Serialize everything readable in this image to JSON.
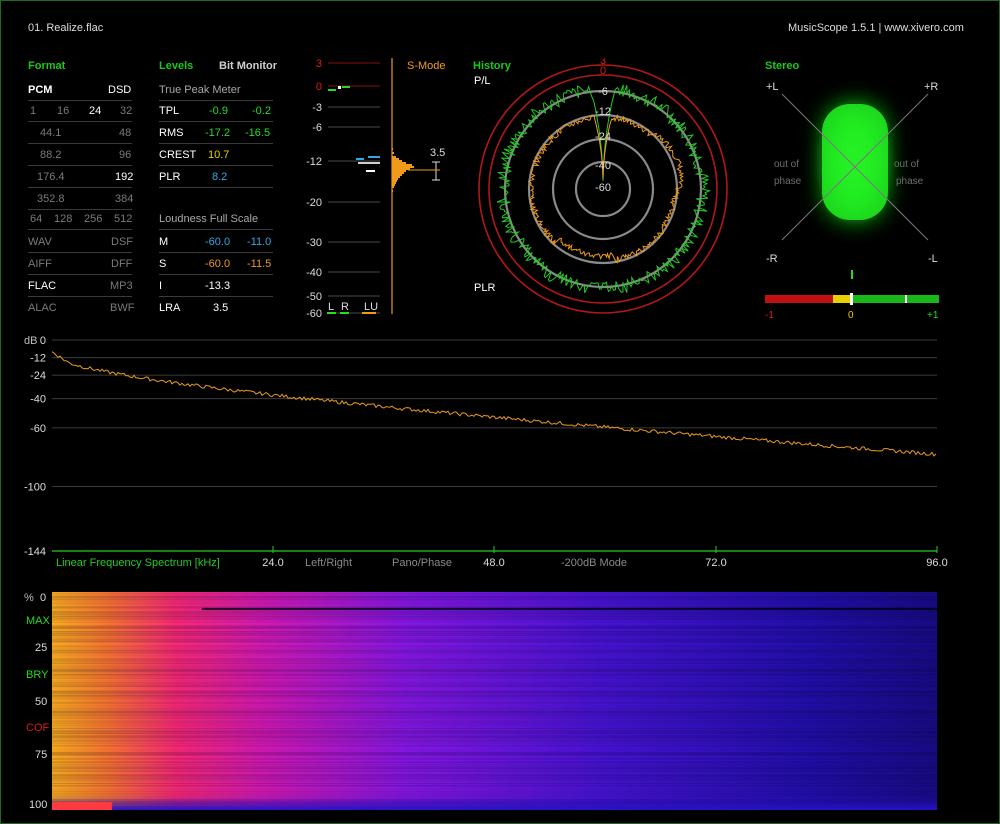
{
  "header": {
    "file": "01. Realize.flac",
    "app": "MusicScope 1.5.1 | www.xivero.com"
  },
  "format": {
    "title": "Format",
    "pcm_label": "PCM",
    "dsd_label": "DSD",
    "bits": [
      "1",
      "16",
      "24",
      "32"
    ],
    "rates_pcm": [
      "44.1",
      "88.2",
      "176.4",
      "352.8"
    ],
    "rates_dsd": [
      "48",
      "96",
      "192",
      "384"
    ],
    "dsd_rates": [
      "64",
      "128",
      "256",
      "512"
    ],
    "containers_left": [
      "WAV",
      "AIFF",
      "FLAC",
      "ALAC"
    ],
    "containers_right": [
      "DSF",
      "DFF",
      "MP3",
      "BWF"
    ]
  },
  "levels": {
    "title": "Levels",
    "bit_monitor": "Bit Monitor",
    "true_peak": "True Peak Meter",
    "rows": [
      {
        "name": "TPL",
        "l": "-0.9",
        "r": "-0.2"
      },
      {
        "name": "RMS",
        "l": "-17.2",
        "r": "-16.5"
      },
      {
        "name": "CREST",
        "l": "10.7"
      },
      {
        "name": "PLR",
        "l": "8.2"
      }
    ],
    "loudness": "Loudness Full Scale",
    "lrows": [
      {
        "name": "M",
        "l": "-60.0",
        "r": "-11.0"
      },
      {
        "name": "S",
        "l": "-60.0",
        "r": "-11.5"
      },
      {
        "name": "I",
        "l": "-13.3"
      },
      {
        "name": "LRA",
        "l": "3.5"
      }
    ]
  },
  "meter": {
    "smode": "S-Mode",
    "ticks": [
      "3",
      "0",
      "-3",
      "-6",
      "-12",
      "-20",
      "-30",
      "-40",
      "-50",
      "-60"
    ],
    "tick_values": [
      3,
      0,
      -3,
      -6,
      -12,
      -20,
      -30,
      -40,
      -50,
      -60
    ],
    "lra": "3.5",
    "l": "L",
    "r": "R",
    "lu": "LU"
  },
  "history": {
    "title": "History",
    "pl": "P/L",
    "plr": "PLR",
    "rings": [
      "3",
      "0",
      "-6",
      "-12",
      "-24",
      "-40",
      "-60"
    ]
  },
  "stereo": {
    "title": "Stereo",
    "pl": "+L",
    "pr": "+R",
    "ml": "-L",
    "mr": "-R",
    "oop_left": [
      "out of",
      "phase"
    ],
    "oop_right": [
      "out of",
      "phase"
    ],
    "corr_labels": [
      "-1",
      "0",
      "+1"
    ]
  },
  "spectrum": {
    "db": "dB",
    "yticks": [
      "0",
      "-12",
      "-24",
      "-40",
      "-60",
      "-100",
      "-144"
    ],
    "ytick_values": [
      0,
      -12,
      -24,
      -40,
      -60,
      -100,
      -144
    ],
    "title": "Linear Frequency Spectrum [kHz]",
    "xticks": [
      "24.0",
      "48.0",
      "72.0",
      "96.0"
    ],
    "modes": [
      "Left/Right",
      "Pano/Phase",
      "-200dB Mode"
    ]
  },
  "spectrogram": {
    "pct": "%",
    "ticks": [
      "0",
      "25",
      "50",
      "75",
      "100"
    ],
    "max": "MAX",
    "bry": "BRY",
    "cof": "COF"
  },
  "colors": {
    "green": "#22dd22",
    "orange": "#f09a1a",
    "red": "#e01818",
    "yellow": "#e8d000",
    "cyan": "#2fa8e8"
  },
  "icons": [
    "lra-bracket-icon",
    "correlation-marker-icon"
  ]
}
